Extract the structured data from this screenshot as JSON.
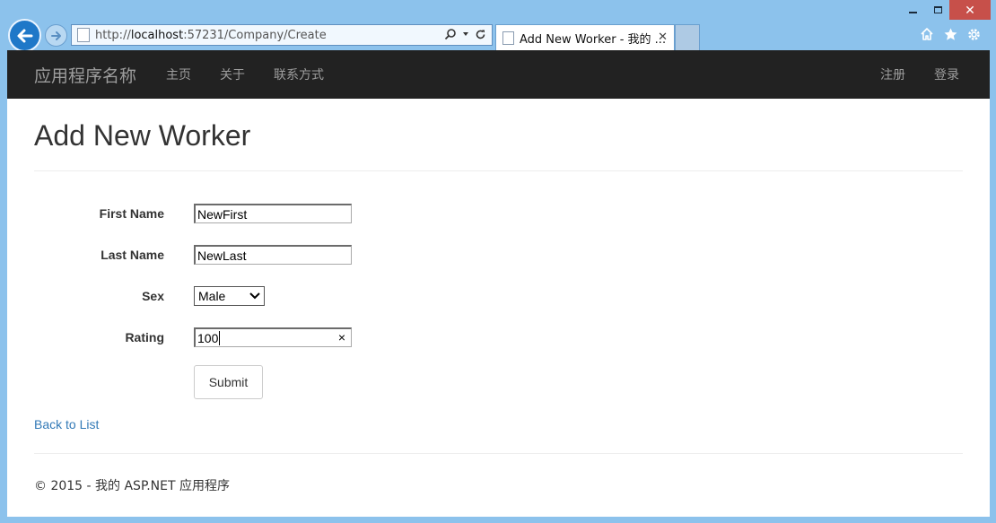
{
  "browser": {
    "url_prefix": "http://",
    "url_host": "localhost",
    "url_rest": ":57231/Company/Create",
    "tab_title": "Add New Worker - 我的 ...",
    "tab_close": "✕",
    "window_close": "✕"
  },
  "navbar": {
    "brand": "应用程序名称",
    "links": [
      "主页",
      "关于",
      "联系方式"
    ],
    "right_links": [
      "注册",
      "登录"
    ]
  },
  "page": {
    "title": "Add New Worker",
    "form": {
      "first_name_label": "First Name",
      "first_name_value": "NewFirst",
      "last_name_label": "Last Name",
      "last_name_value": "NewLast",
      "sex_label": "Sex",
      "sex_value": "Male",
      "rating_label": "Rating",
      "rating_value": "100",
      "rating_clear": "×",
      "submit_label": "Submit"
    },
    "back_link": "Back to List",
    "footer": "© 2015 - 我的 ASP.NET 应用程序"
  },
  "colors": {
    "chrome": "#8cc2ec",
    "navbar": "#222222",
    "link": "#337ab7",
    "close_button": "#c7504a"
  }
}
